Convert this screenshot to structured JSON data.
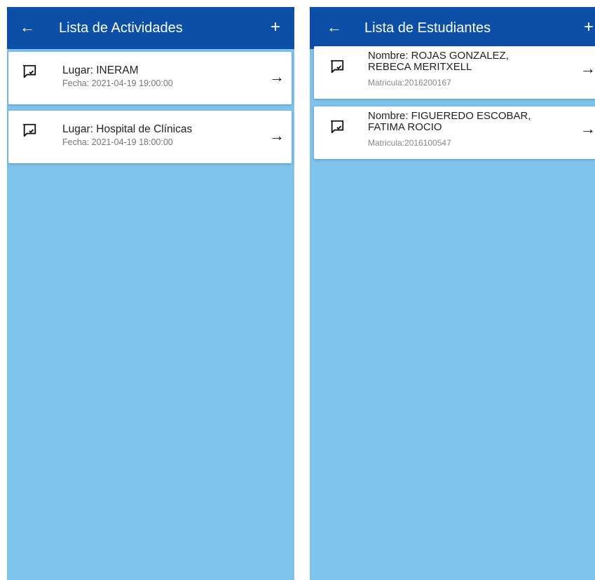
{
  "colors": {
    "appbar": "#0b4fa8",
    "background": "#7ec3ec",
    "card": "#ffffff"
  },
  "activities_screen": {
    "back_icon": "arrow-left-icon",
    "back_glyph": "←",
    "title": "Lista de Actividades",
    "add_icon": "plus-icon",
    "add_glyph": "+",
    "items": [
      {
        "icon": "chat-check-icon",
        "lugar": "Lugar: INERAM",
        "fecha": "Fecha: 2021-04-19 19:00:00",
        "arrow_glyph": "→"
      },
      {
        "icon": "chat-check-icon",
        "lugar": "Lugar: Hospital de Clínicas",
        "fecha": "Fecha: 2021-04-19 18:00:00",
        "arrow_glyph": "→"
      }
    ]
  },
  "students_screen": {
    "back_icon": "arrow-left-icon",
    "back_glyph": "←",
    "title": "Lista de Estudiantes",
    "add_icon": "plus-icon",
    "add_glyph": "+",
    "items": [
      {
        "icon": "chat-check-icon",
        "nombre": "Nombre: ROJAS GONZALEZ, REBECA MERITXELL",
        "matricula": "Matricula:2016200167",
        "arrow_glyph": "→"
      },
      {
        "icon": "chat-check-icon",
        "nombre": "Nombre: FIGUEREDO ESCOBAR, FATIMA ROCIO",
        "matricula": "Matricula:2016100547",
        "arrow_glyph": "→"
      }
    ]
  }
}
